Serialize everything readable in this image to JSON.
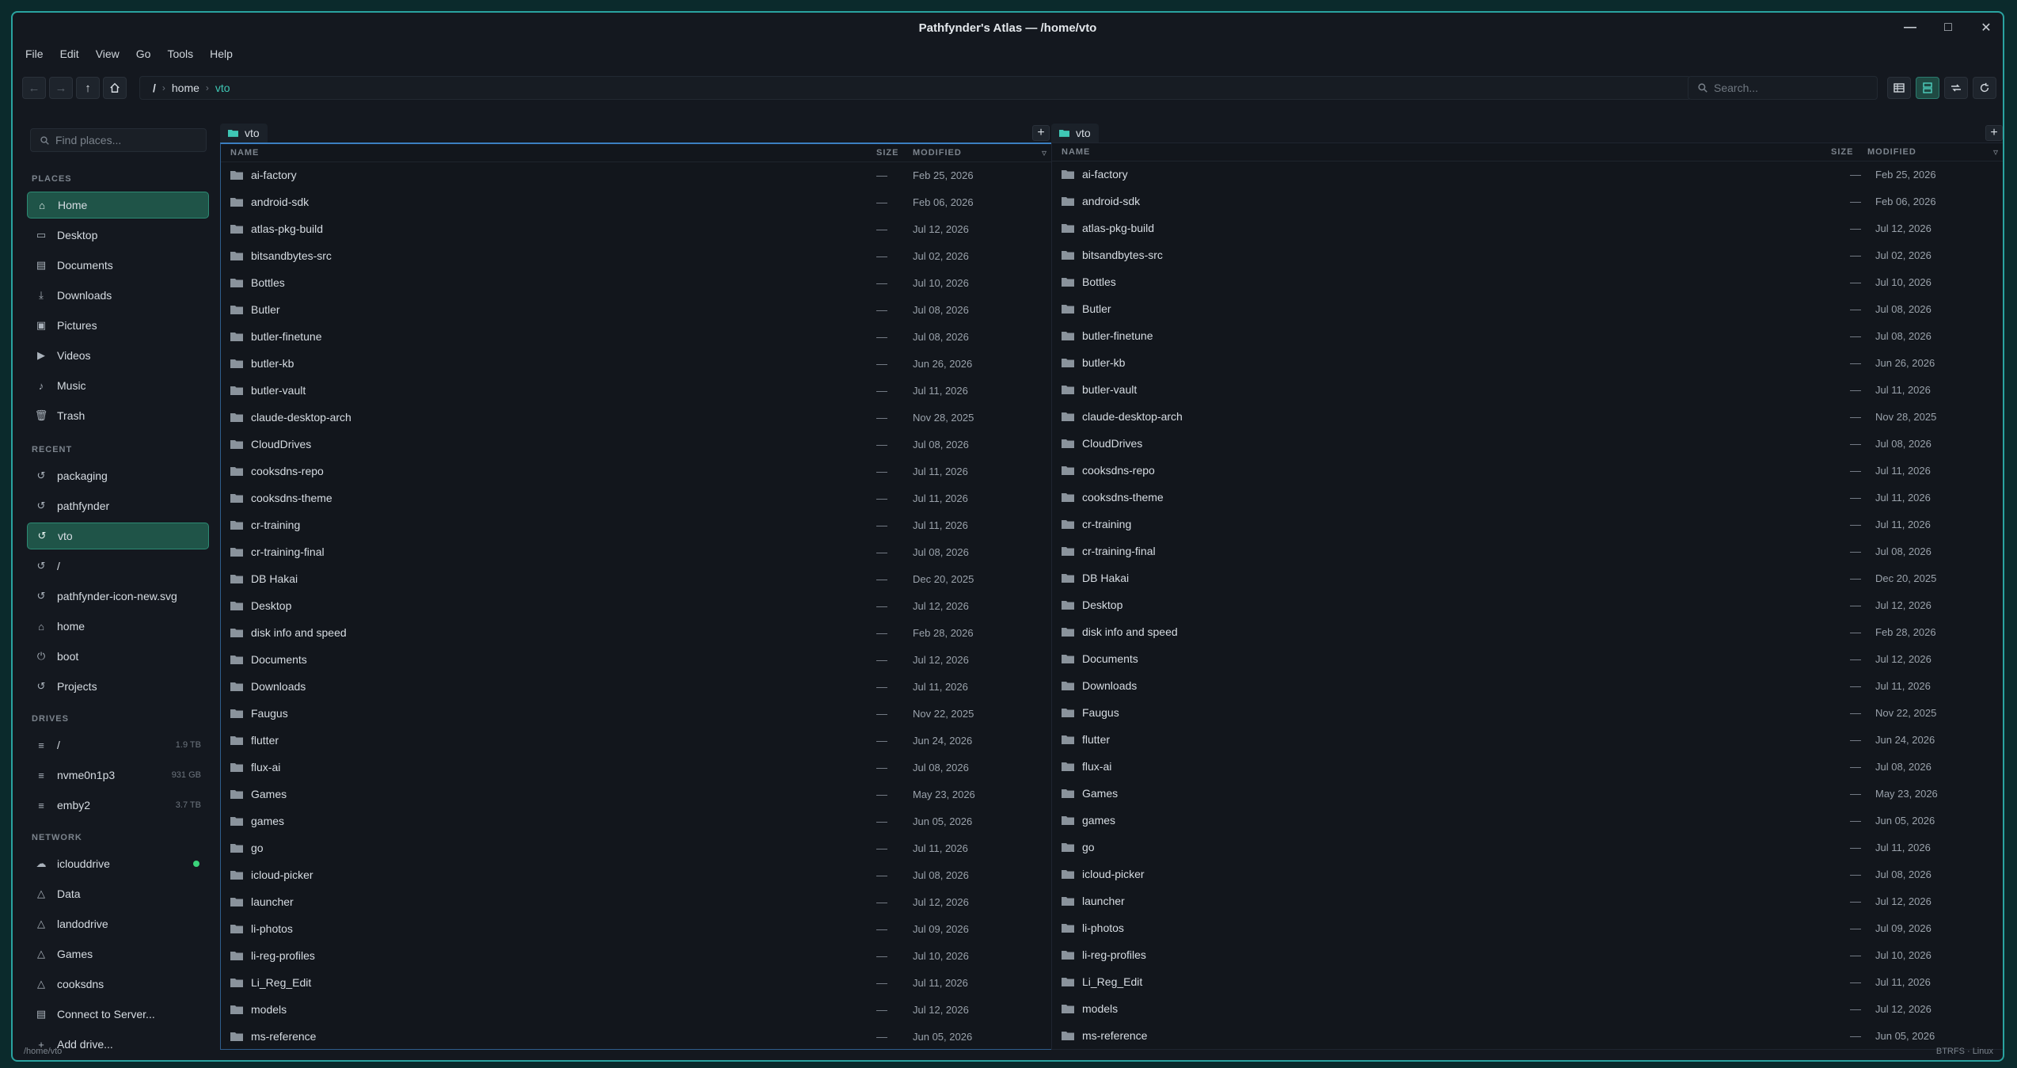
{
  "window": {
    "title": "Pathfynder's Atlas  —  /home/vto"
  },
  "menu": [
    "File",
    "Edit",
    "View",
    "Go",
    "Tools",
    "Help"
  ],
  "path": {
    "root": "/",
    "segments": [
      "home",
      "vto"
    ]
  },
  "search": {
    "placeholder": "Search..."
  },
  "sidebar": {
    "find_placeholder": "Find places...",
    "places_header": "PLACES",
    "places": [
      {
        "label": "Home",
        "icon": "home-icon",
        "selected": true
      },
      {
        "label": "Desktop",
        "icon": "desktop-icon"
      },
      {
        "label": "Documents",
        "icon": "document-icon"
      },
      {
        "label": "Downloads",
        "icon": "download-icon"
      },
      {
        "label": "Pictures",
        "icon": "picture-icon"
      },
      {
        "label": "Videos",
        "icon": "video-icon"
      },
      {
        "label": "Music",
        "icon": "music-icon"
      },
      {
        "label": "Trash",
        "icon": "trash-icon"
      }
    ],
    "recent_header": "RECENT",
    "recent": [
      {
        "label": "packaging"
      },
      {
        "label": "pathfynder"
      },
      {
        "label": "vto",
        "selected": true
      },
      {
        "label": "/"
      },
      {
        "label": "pathfynder-icon-new.svg"
      },
      {
        "label": "home"
      },
      {
        "label": "boot"
      },
      {
        "label": "Projects"
      }
    ],
    "drives_header": "DRIVES",
    "drives": [
      {
        "label": "/",
        "meta": "1.9 TB"
      },
      {
        "label": "nvme0n1p3",
        "meta": "931 GB"
      },
      {
        "label": "emby2",
        "meta": "3.7 TB"
      }
    ],
    "network_header": "NETWORK",
    "network": [
      {
        "label": "iclouddrive",
        "icon": "cloud-icon",
        "online": true
      },
      {
        "label": "Data",
        "icon": "network-share-icon"
      },
      {
        "label": "landodrive",
        "icon": "network-share-icon"
      },
      {
        "label": "Games",
        "icon": "network-share-icon"
      },
      {
        "label": "cooksdns",
        "icon": "network-share-icon"
      },
      {
        "label": "Connect to Server...",
        "icon": "server-icon"
      },
      {
        "label": "Add drive...",
        "icon": "plus-icon"
      }
    ]
  },
  "pane": {
    "tab_label": "vto",
    "columns": {
      "name": "NAME",
      "size": "SIZE",
      "modified": "MODIFIED"
    },
    "rows": [
      {
        "name": "ai-factory",
        "size": "—",
        "modified": "Feb 25, 2026"
      },
      {
        "name": "android-sdk",
        "size": "—",
        "modified": "Feb 06, 2026"
      },
      {
        "name": "atlas-pkg-build",
        "size": "—",
        "modified": "Jul 12, 2026"
      },
      {
        "name": "bitsandbytes-src",
        "size": "—",
        "modified": "Jul 02, 2026"
      },
      {
        "name": "Bottles",
        "size": "—",
        "modified": "Jul 10, 2026"
      },
      {
        "name": "Butler",
        "size": "—",
        "modified": "Jul 08, 2026"
      },
      {
        "name": "butler-finetune",
        "size": "—",
        "modified": "Jul 08, 2026"
      },
      {
        "name": "butler-kb",
        "size": "—",
        "modified": "Jun 26, 2026"
      },
      {
        "name": "butler-vault",
        "size": "—",
        "modified": "Jul 11, 2026"
      },
      {
        "name": "claude-desktop-arch",
        "size": "—",
        "modified": "Nov 28, 2025"
      },
      {
        "name": "CloudDrives",
        "size": "—",
        "modified": "Jul 08, 2026"
      },
      {
        "name": "cooksdns-repo",
        "size": "—",
        "modified": "Jul 11, 2026"
      },
      {
        "name": "cooksdns-theme",
        "size": "—",
        "modified": "Jul 11, 2026"
      },
      {
        "name": "cr-training",
        "size": "—",
        "modified": "Jul 11, 2026"
      },
      {
        "name": "cr-training-final",
        "size": "—",
        "modified": "Jul 08, 2026"
      },
      {
        "name": "DB Hakai",
        "size": "—",
        "modified": "Dec 20, 2025"
      },
      {
        "name": "Desktop",
        "size": "—",
        "modified": "Jul 12, 2026"
      },
      {
        "name": "disk info and speed",
        "size": "—",
        "modified": "Feb 28, 2026"
      },
      {
        "name": "Documents",
        "size": "—",
        "modified": "Jul 12, 2026"
      },
      {
        "name": "Downloads",
        "size": "—",
        "modified": "Jul 11, 2026"
      },
      {
        "name": "Faugus",
        "size": "—",
        "modified": "Nov 22, 2025"
      },
      {
        "name": "flutter",
        "size": "—",
        "modified": "Jun 24, 2026"
      },
      {
        "name": "flux-ai",
        "size": "—",
        "modified": "Jul 08, 2026"
      },
      {
        "name": "Games",
        "size": "—",
        "modified": "May 23, 2026"
      },
      {
        "name": "games",
        "size": "—",
        "modified": "Jun 05, 2026"
      },
      {
        "name": "go",
        "size": "—",
        "modified": "Jul 11, 2026"
      },
      {
        "name": "icloud-picker",
        "size": "—",
        "modified": "Jul 08, 2026"
      },
      {
        "name": "launcher",
        "size": "—",
        "modified": "Jul 12, 2026"
      },
      {
        "name": "li-photos",
        "size": "—",
        "modified": "Jul 09, 2026"
      },
      {
        "name": "li-reg-profiles",
        "size": "—",
        "modified": "Jul 10, 2026"
      },
      {
        "name": "Li_Reg_Edit",
        "size": "—",
        "modified": "Jul 11, 2026"
      },
      {
        "name": "models",
        "size": "—",
        "modified": "Jul 12, 2026"
      },
      {
        "name": "ms-reference",
        "size": "—",
        "modified": "Jun 05, 2026"
      }
    ]
  },
  "status": {
    "left": "/home/vto",
    "right": "BTRFS · Linux"
  },
  "colors": {
    "accent": "#3fc7b5",
    "selection": "#1f5448",
    "border": "#2aa3a0"
  }
}
